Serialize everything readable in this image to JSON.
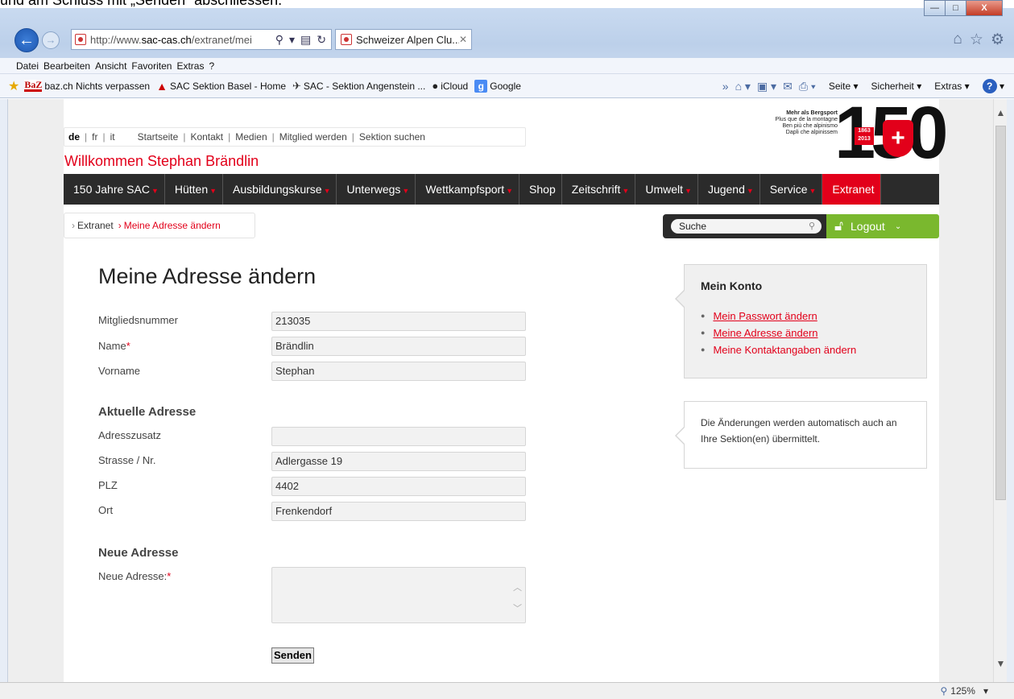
{
  "caption": "und am Schluss mit „Senden“ abschliessen.",
  "window_controls": {
    "minimize": "—",
    "maximize": "□",
    "close": "X"
  },
  "browser": {
    "url_prefix": "http://www.",
    "url_domain": "sac-cas.ch",
    "url_suffix": "/extranet/mei",
    "tab_title": "Schweizer Alpen Clu...",
    "menu": [
      "Datei",
      "Bearbeiten",
      "Ansicht",
      "Favoriten",
      "Extras",
      "?"
    ],
    "favorites": [
      "baz.ch Nichts verpassen",
      "SAC Sektion Basel - Home",
      "SAC - Sektion Angenstein ...",
      "iCloud",
      "Google"
    ],
    "baz_logo": "BaZ",
    "command_bar": {
      "page": "Seite",
      "security": "Sicherheit",
      "extras": "Extras"
    },
    "zoom": "125%"
  },
  "site": {
    "lang": {
      "de": "de",
      "fr": "fr",
      "it": "it"
    },
    "top_links": [
      "Startseite",
      "Kontakt",
      "Medien",
      "Mitglied werden",
      "Sektion suchen"
    ],
    "welcome": "Willkommen  Stephan Brändlin",
    "logo": {
      "line1": "Mehr als Bergsport",
      "line2": "Plus que de la montagne",
      "line3": "Ben più che alpinismo",
      "line4": "Dapli che alpinissem",
      "number": "150",
      "years": "1863 2013"
    },
    "nav": [
      {
        "label": "150 Jahre SAC",
        "dropdown": true
      },
      {
        "label": "Hütten",
        "dropdown": true
      },
      {
        "label": "Ausbildungskurse",
        "dropdown": true
      },
      {
        "label": "Unterwegs",
        "dropdown": true
      },
      {
        "label": "Wettkampfsport",
        "dropdown": true
      },
      {
        "label": "Shop",
        "dropdown": false
      },
      {
        "label": "Zeitschrift",
        "dropdown": true
      },
      {
        "label": "Umwelt",
        "dropdown": true
      },
      {
        "label": "Jugend",
        "dropdown": true
      },
      {
        "label": "Service",
        "dropdown": true
      },
      {
        "label": "Extranet",
        "dropdown": false,
        "active": true
      }
    ],
    "breadcrumb": {
      "root": "Extranet",
      "current": "Meine Adresse ändern"
    },
    "search_placeholder": "Suche",
    "logout": "Logout"
  },
  "form": {
    "title": "Meine Adresse ändern",
    "fields": {
      "member_no": {
        "label": "Mitgliedsnummer",
        "value": "213035"
      },
      "name": {
        "label": "Name",
        "value": "Brändlin"
      },
      "firstname": {
        "label": "Vorname",
        "value": "Stephan"
      }
    },
    "current_address": {
      "heading": "Aktuelle Adresse",
      "addition": {
        "label": "Adresszusatz",
        "value": ""
      },
      "street": {
        "label": "Strasse / Nr.",
        "value": "Adlergasse 19"
      },
      "zip": {
        "label": "PLZ",
        "value": "4402"
      },
      "city": {
        "label": "Ort",
        "value": "Frenkendorf"
      }
    },
    "new_address": {
      "heading": "Neue Adresse",
      "label": "Neue Adresse:",
      "value": ""
    },
    "required_marker": "*",
    "submit": "Senden"
  },
  "sidebar": {
    "account_title": "Mein Konto",
    "links": [
      "Mein Passwort ändern",
      "Meine Adresse ändern",
      "Meine Kontaktangaben ändern"
    ],
    "note": "Die Änderungen werden automatisch auch an Ihre Sektion(en) übermittelt."
  },
  "colors": {
    "accent": "#e2001a",
    "nav_bg": "#2b2b2b",
    "logout": "#7ab82e"
  }
}
